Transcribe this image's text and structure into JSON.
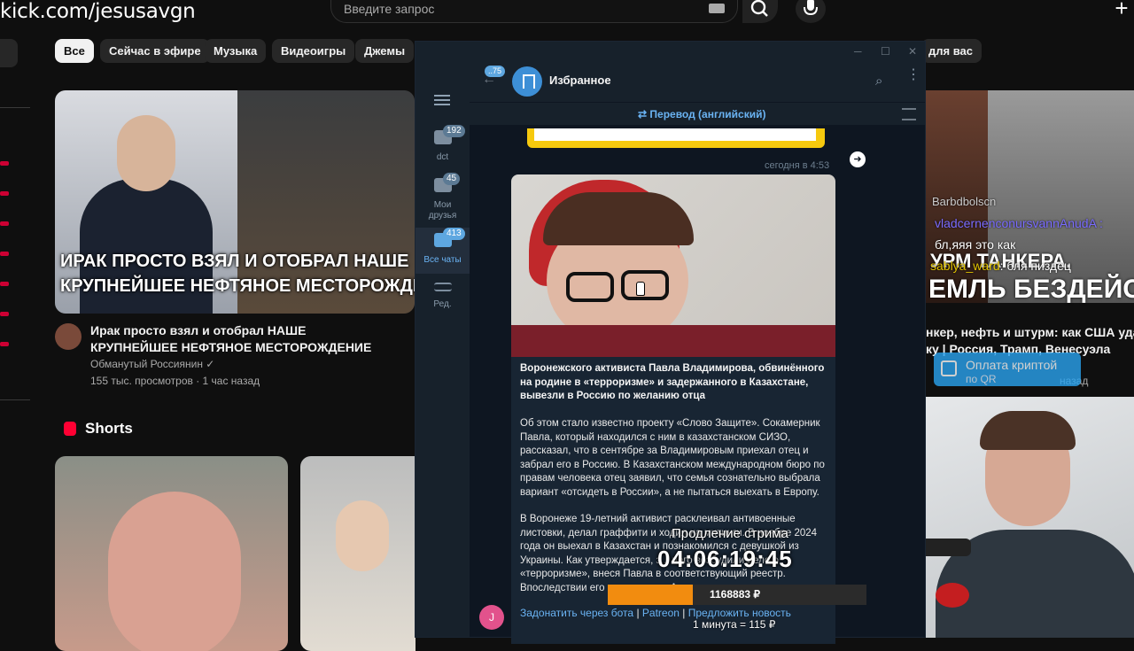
{
  "browser": {
    "url": "kick.com/jesusavgn",
    "search_placeholder": "Введите запрос"
  },
  "chips": [
    "Все",
    "Сейчас в эфире",
    "Музыка",
    "Видеоигры",
    "Джемы",
    "для вас"
  ],
  "video": {
    "thumb_caption_line1": "ИРАК ПРОСТО ВЗЯЛ И ОТОБРАЛ НАШЕ",
    "thumb_caption_line2": "КРУПНЕЙШЕЕ НЕФТЯНОЕ МЕСТОРОЖДЕНИ",
    "title": "Ирак просто взял и отобрал НАШЕ КРУПНЕЙШЕЕ НЕФТЯНОЕ МЕСТОРОЖДЕНИЕ",
    "channel": "Обманутый Россиянин ✓",
    "meta": "155 тыс. просмотров · 1 час назад"
  },
  "shorts": {
    "label": "Shorts"
  },
  "right_video": {
    "caption1": "УРМ ТАНКЕРА.",
    "caption2": "ЕМЛЬ БЕЗДЕЙСТ",
    "title_line1": "нкер, нефть и штурм: как США удари",
    "title_line2": "ку | Россия, Трамп, Венесуэла",
    "time_ago": "назад"
  },
  "chat_overlay": {
    "line0": "Barbdbolscn",
    "line1": "vladcernenconursvannAnudA :",
    "line2": "бл,яяя это как",
    "line3_user": "sablya_ward",
    "line3_text": ": бля пиздец"
  },
  "crypto_button": {
    "label": "Оплата криптой",
    "sub": "по QR"
  },
  "telegram": {
    "back_badge": "75",
    "chat_title": "Избранное",
    "translate_label": "Перевод (английский)",
    "folders": [
      {
        "label": "dct",
        "badge": "192"
      },
      {
        "label": "Мои друзья",
        "badge": "45"
      },
      {
        "label": "Все чаты",
        "badge": "413"
      },
      {
        "label": "Ред.",
        "badge": ""
      }
    ],
    "msg_time": "сегодня в 4:53",
    "msg_bold": "Воронежского активиста Павла Владимирова, обвинённого на родине в «терроризме» и задержанного в Казахстане, вывезли в Россию по желанию отца",
    "msg_p1": "Об этом стало известно проекту «Слово Защите». Сокамерник Павла, который находился с ним в казахстанском СИЗО, рассказал, что в сентябре за Владимировым приехал отец и забрал его в Россию. В Казахстанском международном бюро по правам человека отец заявил, что семья сознательно выбрала вариант «отсидеть в России», а не пытаться выехать в Европу.",
    "msg_p2": "В Воронеже 19-летний активист расклеивал антивоенные листовки, делал граффити и ходил на митинги. В ноябре 2024 года он выехал в Казахстан и познакомился с девушкой из Украины. Как утверждается, з... него возбудили дело о «терроризме», внеся Павла в соответствующий реестр. Впоследствии его задержали в Алматы.",
    "avatar_letter": "J",
    "link1": "Задонатить через бота",
    "link2": "Patreon",
    "link3": "Предложить новость",
    "sep": "|"
  },
  "stream_overlay": {
    "title": "Продление стрима",
    "timer": "04:06:19:45",
    "amount": "1168883 ₽",
    "progress": 0.33,
    "rate": "1 минута = 115 ₽"
  },
  "colors": {
    "yt_bg": "#0f0f0f",
    "tg_bg": "#0e1621",
    "tg_accent": "#6ab3f3",
    "overlay_fill": "#f28c0f"
  }
}
